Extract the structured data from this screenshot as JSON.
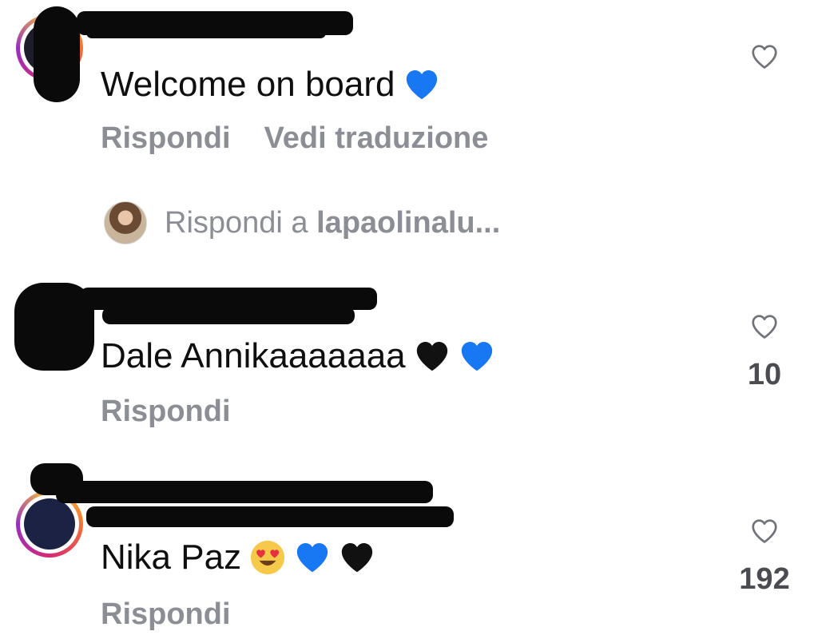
{
  "comments": [
    {
      "text": "Welcome on board",
      "emojis": [
        "blue-heart"
      ],
      "actions": [
        "Rispondi",
        "Vedi traduzione"
      ],
      "likes": "",
      "reply_prompt": {
        "prefix": "Rispondi a ",
        "username": "lapaolinalu..."
      }
    },
    {
      "text": "Dale Annikaaaaaaa",
      "emojis": [
        "black-heart",
        "blue-heart"
      ],
      "actions": [
        "Rispondi"
      ],
      "likes": "10"
    },
    {
      "text": "Nika Paz",
      "emojis": [
        "heart-eyes",
        "blue-heart",
        "black-heart"
      ],
      "actions": [
        "Rispondi"
      ],
      "likes": "192"
    }
  ],
  "colors": {
    "text": "#0f0f0f",
    "muted": "#8b8e95",
    "count": "#4a4c52",
    "blue_heart": "#1877f2",
    "black_heart": "#111111",
    "redaction": "#0a0a0a"
  }
}
